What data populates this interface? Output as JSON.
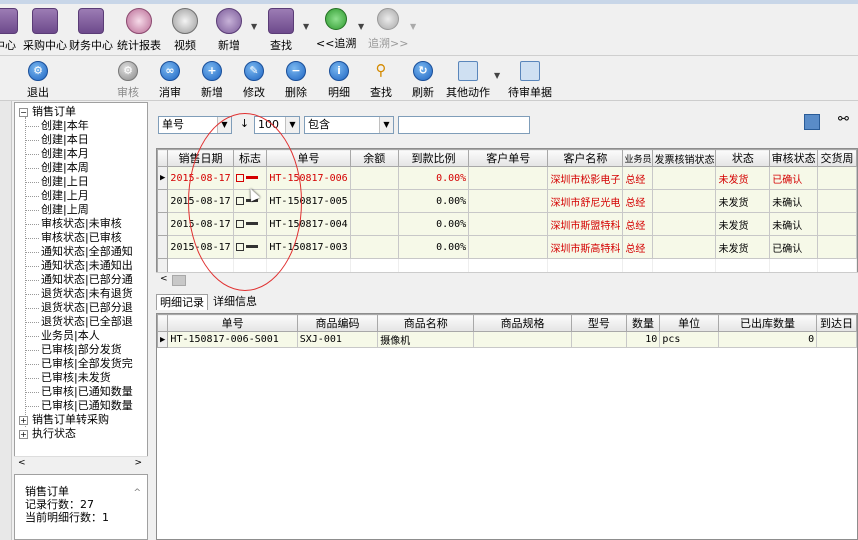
{
  "top_toolbar": [
    {
      "label": "中心",
      "icon": "hub-icon"
    },
    {
      "label": "采购中心",
      "icon": "purchase-icon"
    },
    {
      "label": "财务中心",
      "icon": "finance-icon"
    },
    {
      "label": "统计报表",
      "icon": "report-icon"
    },
    {
      "label": "视频",
      "icon": "video-icon"
    },
    {
      "label": "新增",
      "icon": "new-icon"
    },
    {
      "label": "查找",
      "icon": "find-icon"
    },
    {
      "label": "<<追溯",
      "icon": "trace-back-icon"
    },
    {
      "label": "追溯>>",
      "icon": "trace-forward-icon"
    }
  ],
  "toolbar": {
    "exit": "退出",
    "audit": "审核",
    "cancel_audit": "消审",
    "add": "新增",
    "edit": "修改",
    "delete": "删除",
    "detail": "明细",
    "search": "查找",
    "refresh": "刷新",
    "other": "其他动作",
    "pending": "待审单据"
  },
  "tree": {
    "root": "销售订单",
    "items": [
      "创建|本年",
      "创建|本日",
      "创建|本月",
      "创建|本周",
      "创建|上日",
      "创建|上月",
      "创建|上周",
      "审核状态|未审核",
      "审核状态|已审核",
      "通知状态|全部通知",
      "通知状态|未通知出",
      "通知状态|已部分通",
      "退货状态|未有退货",
      "退货状态|已部分退",
      "退货状态|已全部退",
      "业务员|本人",
      "已审核|部分发货",
      "已审核|全部发货完",
      "已审核|未发货",
      "已审核|已通知数量",
      "已审核|已通知数量"
    ],
    "nodes": [
      "销售订单转采购",
      "执行状态"
    ]
  },
  "status": {
    "title": "销售订单",
    "rows": "记录行数：27",
    "detail_rows": "当前明细行数：1"
  },
  "filter": {
    "field": "单号",
    "sort": "↓",
    "limit": "100",
    "op": "包含",
    "value": ""
  },
  "grid": {
    "columns": [
      "销售日期",
      "标志",
      "单号",
      "余额",
      "到款比例",
      "客户单号",
      "客户名称",
      "业务员",
      "发票核销状态",
      "状态",
      "审核状态",
      "交货周"
    ],
    "rows": [
      {
        "date": "2015-08-17",
        "no": "HT-150817-006",
        "balance": "",
        "ratio": "0.00%",
        "cust_no": "",
        "cust": "深圳市松影电子",
        "sales": "总经",
        "inv": "",
        "state": "未发货",
        "audit": "已确认",
        "delivery": ""
      },
      {
        "date": "2015-08-17",
        "no": "HT-150817-005",
        "balance": "",
        "ratio": "0.00%",
        "cust_no": "",
        "cust": "深圳市舒尼光电",
        "sales": "总经",
        "inv": "",
        "state": "未发货",
        "audit": "未确认",
        "delivery": ""
      },
      {
        "date": "2015-08-17",
        "no": "HT-150817-004",
        "balance": "",
        "ratio": "0.00%",
        "cust_no": "",
        "cust": "深圳市斯盟特科",
        "sales": "总经",
        "inv": "",
        "state": "未发货",
        "audit": "未确认",
        "delivery": ""
      },
      {
        "date": "2015-08-17",
        "no": "HT-150817-003",
        "balance": "",
        "ratio": "0.00%",
        "cust_no": "",
        "cust": "深圳市斯高特科",
        "sales": "总经",
        "inv": "",
        "state": "未发货",
        "audit": "已确认",
        "delivery": ""
      }
    ]
  },
  "tabs": [
    "明细记录",
    "详细信息"
  ],
  "detail": {
    "columns": [
      "单号",
      "商品编码",
      "商品名称",
      "商品规格",
      "型号",
      "数量",
      "单位",
      "已出库数量",
      "到达日"
    ],
    "row": {
      "no": "HT-150817-006-S001",
      "code": "SXJ-001",
      "name": "摄像机",
      "spec": "",
      "model": "",
      "qty": "10",
      "unit": "pcs",
      "out": "0",
      "arrive": ""
    }
  }
}
